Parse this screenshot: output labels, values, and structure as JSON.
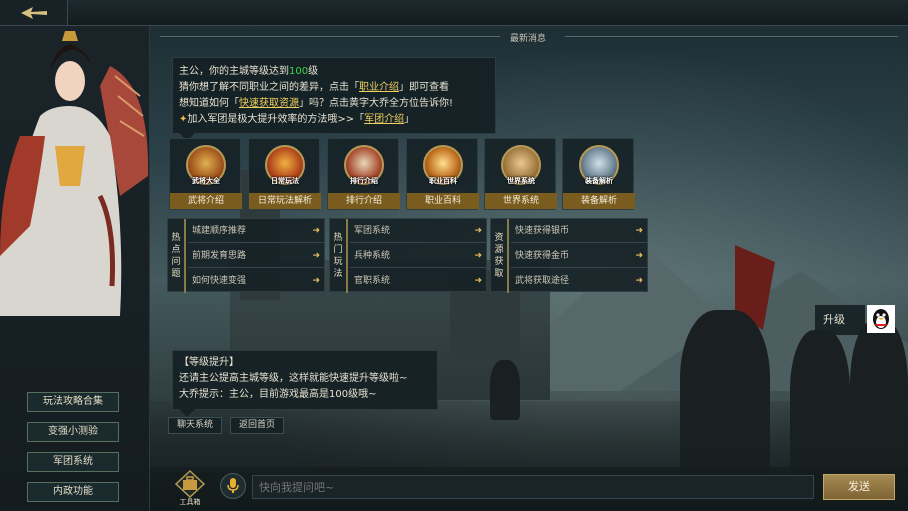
{
  "header": {
    "news_title": "最新消息"
  },
  "sidebar": {
    "menu": [
      "玩法攻略合集",
      "变强小测验",
      "军团系统",
      "内政功能"
    ]
  },
  "message1": {
    "line1_a": "主公，你的主城等级达到",
    "line1_level": "100",
    "line1_b": "级",
    "line2_a": "猜你想了解不同职业之间的差异，点击「",
    "line2_link": "职业介绍",
    "line2_b": "」即可查看",
    "line3_a": "想知道如何「",
    "line3_link": "快速获取资源",
    "line3_b": "」吗？点击黄字大乔全方位告诉你!",
    "line4_a": "加入军团是极大提升效率的方法哦>>「",
    "line4_link": "军团介绍",
    "line4_b": "」"
  },
  "tiles": [
    {
      "pic_label": "武将大全",
      "label": "武将介绍",
      "icon": "general-icon"
    },
    {
      "pic_label": "日常玩法",
      "label": "日常玩法解析",
      "icon": "book-icon"
    },
    {
      "pic_label": "排行介绍",
      "label": "排行介绍",
      "icon": "scroll-icon"
    },
    {
      "pic_label": "职业百科",
      "label": "职业百科",
      "icon": "sword-icon"
    },
    {
      "pic_label": "世界系统",
      "label": "世界系统",
      "icon": "map-icon"
    },
    {
      "pic_label": "装备解析",
      "label": "装备解析",
      "icon": "armor-icon"
    }
  ],
  "guides": [
    {
      "title": "热点问题",
      "items": [
        "城建顺序推荐",
        "前期发育思路",
        "如何快速变强"
      ]
    },
    {
      "title": "热门玩法",
      "items": [
        "军团系统",
        "兵种系统",
        "官职系统"
      ]
    },
    {
      "title": "资源获取",
      "items": [
        "快速获得银币",
        "快速获得金币",
        "武将获取途径"
      ]
    }
  ],
  "upgrade": {
    "label": "升级"
  },
  "message2": {
    "line1": "【等级提升】",
    "line2": "还请主公提高主城等级，这样就能快速提升等级啦~",
    "line3": "大乔提示：主公，目前游戏最高是100级哦~"
  },
  "chips": [
    "聊天系统",
    "返回首页"
  ],
  "bottom": {
    "toolbox_label": "工具箱",
    "input_placeholder": "快向我提问吧~",
    "send_label": "发送"
  },
  "colors": {
    "link": "#f0d060",
    "level": "#38d848",
    "accent_gold": "#a58a52"
  }
}
